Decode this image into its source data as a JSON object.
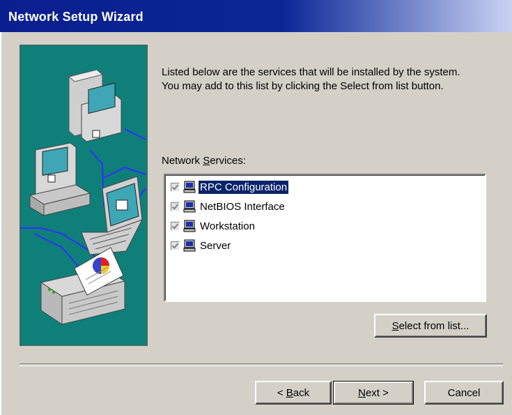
{
  "window": {
    "title": "Network Setup Wizard"
  },
  "description": {
    "line1": "Listed below are the services that will be installed by the system.",
    "line2": "You may add to this list by clicking the Select from list button."
  },
  "services": {
    "label_pre": "Network ",
    "label_mnemonic": "S",
    "label_post": "ervices:",
    "items": [
      {
        "label": "RPC Configuration",
        "checked": true,
        "selected": true,
        "icon": "network-service-icon"
      },
      {
        "label": "NetBIOS Interface",
        "checked": true,
        "selected": false,
        "icon": "network-service-icon"
      },
      {
        "label": "Workstation",
        "checked": true,
        "selected": false,
        "icon": "network-service-icon"
      },
      {
        "label": "Server",
        "checked": true,
        "selected": false,
        "icon": "network-service-icon"
      }
    ]
  },
  "buttons": {
    "select_mnemonic": "S",
    "select_rest": "elect from list...",
    "back_prefix": "< ",
    "back_mnemonic": "B",
    "back_rest": "ack",
    "next_mnemonic": "N",
    "next_rest": "ext >",
    "cancel": "Cancel"
  },
  "colors": {
    "titlebar": "#0a246a",
    "face": "#d4d0c8",
    "art_background": "#0f7f7a",
    "selection": "#0a246a"
  }
}
